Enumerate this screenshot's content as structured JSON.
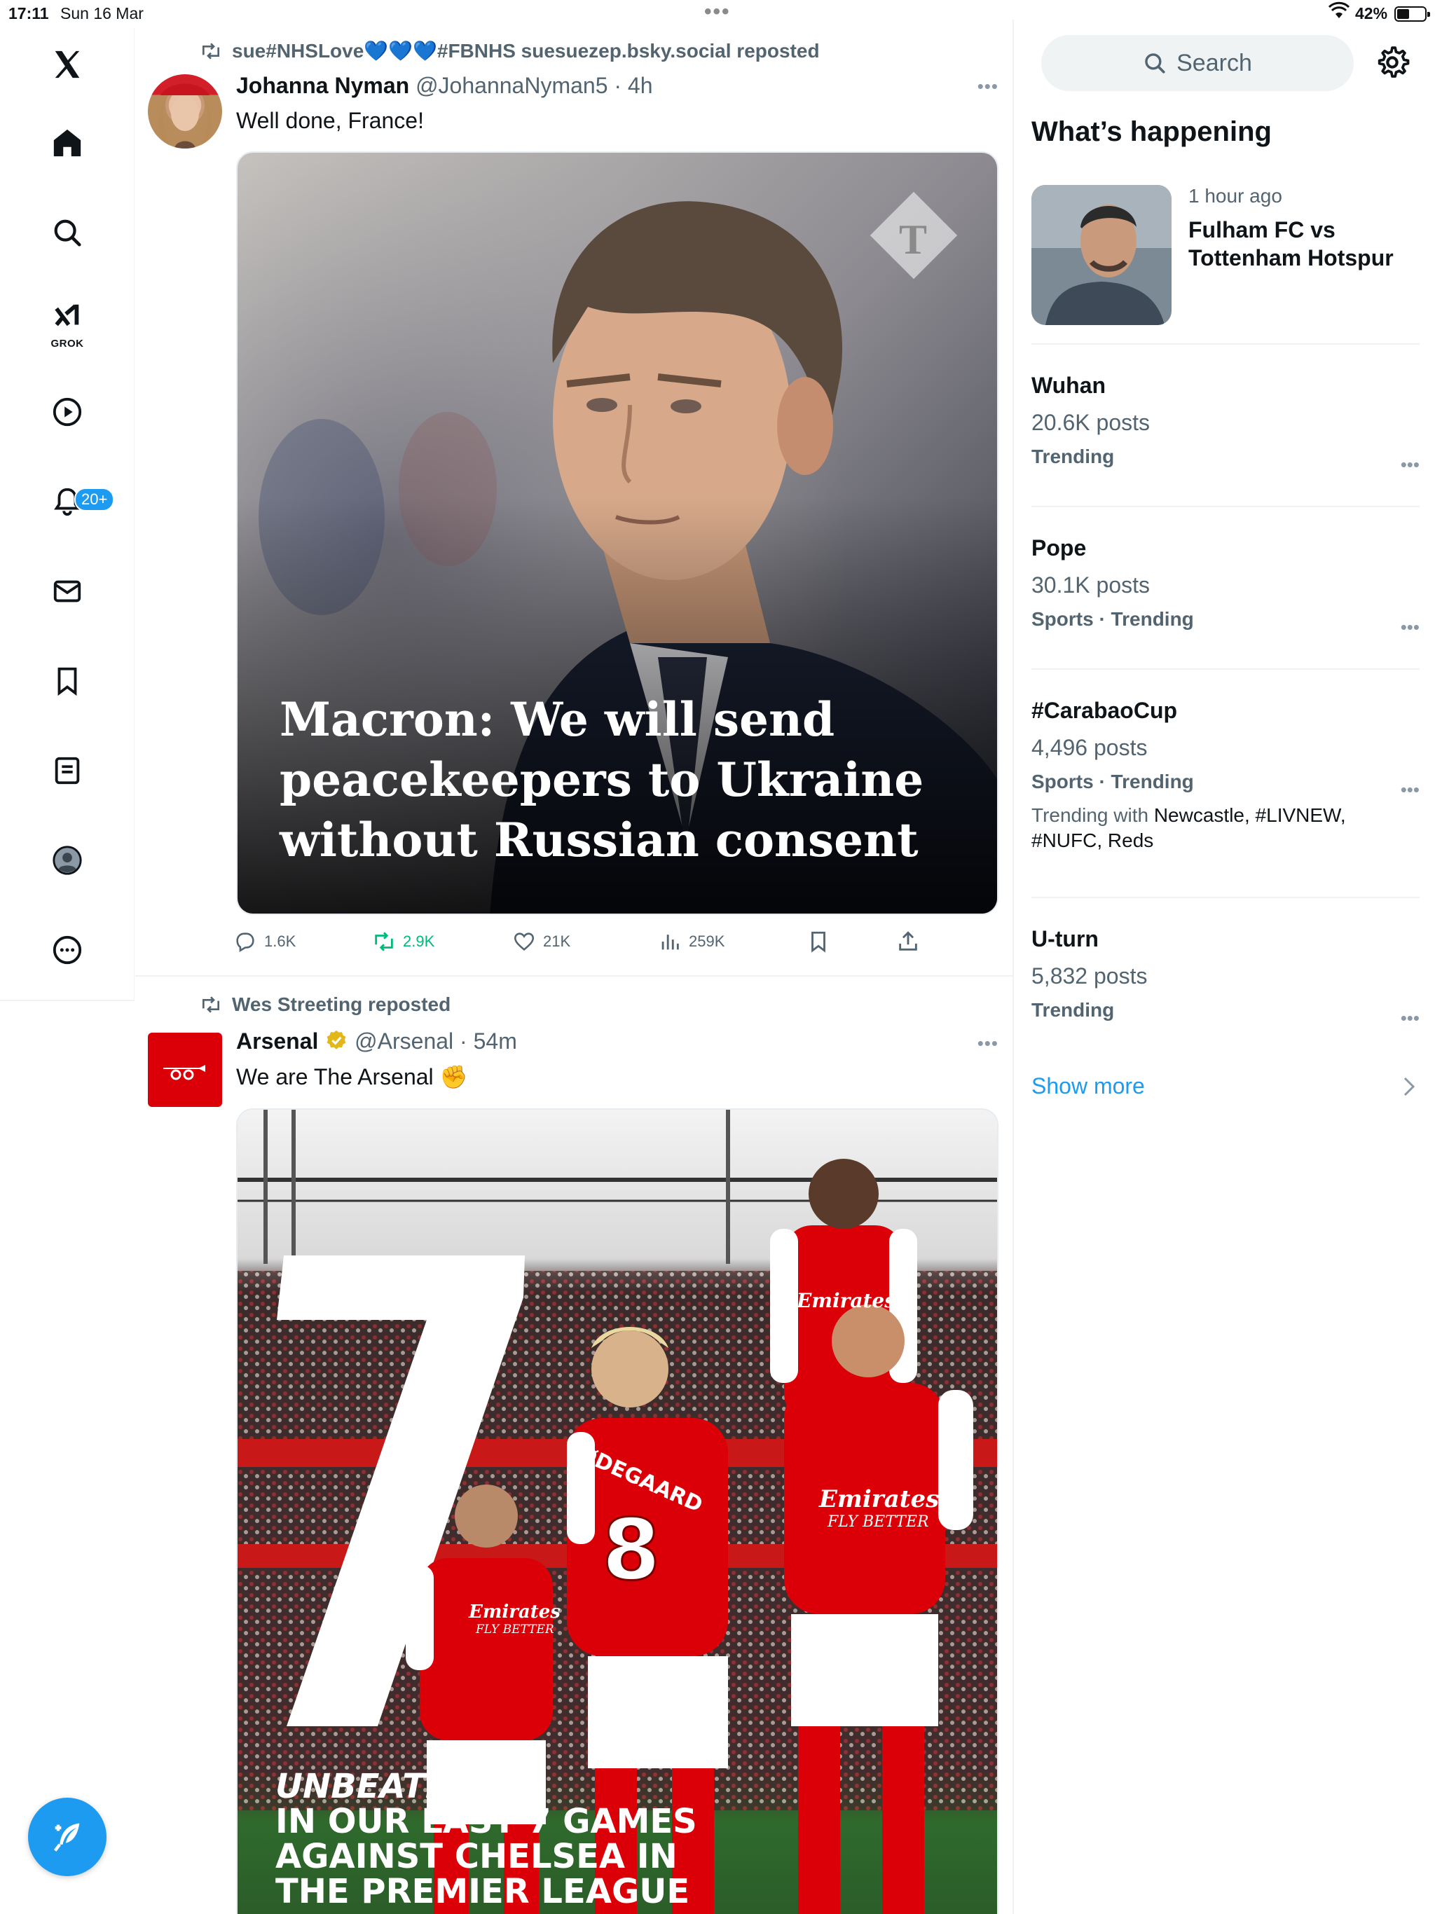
{
  "status": {
    "time": "17:11",
    "date": "Sun 16 Mar",
    "battery": "42%"
  },
  "nav": {
    "grok_label": "GROK",
    "notifications_badge": "20+"
  },
  "feed": {
    "tweets": [
      {
        "repost_by": "sue#NHSLove💙💙💙#FBNHS suesuezep.bsky.social reposted",
        "name": "Johanna Nyman",
        "handle": "@JohannaNyman5",
        "time": "4h",
        "text": "Well done, France!",
        "media_headline": "Macron: We will send peacekeepers to Ukraine without Russian consent",
        "media_logo": "T",
        "replies": "1.6K",
        "reposts": "2.9K",
        "likes": "21K",
        "views": "259K"
      },
      {
        "repost_by": "Wes Streeting reposted",
        "name": "Arsenal",
        "handle": "@Arsenal",
        "time": "54m",
        "text": "We are The Arsenal ✊",
        "media_big_number": "7",
        "media_caption_1": "UNBEATEN",
        "media_caption_2": "IN OUR LAST 7 GAMES",
        "media_caption_3": "AGAINST CHELSEA IN",
        "media_caption_4": "THE PREMIER LEAGUE",
        "shirt_sponsor": "Emirates",
        "shirt_sponsor_sub": "FLY BETTER",
        "player_name": "ØDEGAARD",
        "player_number": "8"
      }
    ]
  },
  "sidebar": {
    "search_placeholder": "Search",
    "title": "What’s happening",
    "featured": {
      "time": "1 hour ago",
      "title": "Fulham FC vs Tottenham Hotspur"
    },
    "trends": [
      {
        "name": "Wuhan",
        "count": "20.6K posts",
        "meta": "Trending"
      },
      {
        "name": "Pope",
        "count": "30.1K posts",
        "meta": "Sports · Trending"
      },
      {
        "name": "#CarabaoCup",
        "count": "4,496 posts",
        "meta": "Sports · Trending",
        "with_label": "Trending with",
        "with_items": "Newcastle, #LIVNEW, #NUFC, Reds"
      },
      {
        "name": "U-turn",
        "count": "5,832 posts",
        "meta": "Trending"
      }
    ],
    "show_more": "Show more"
  },
  "colors": {
    "accent": "#1d9bf0",
    "repost_green": "#00ba7c",
    "arsenal_red": "#db0007"
  }
}
